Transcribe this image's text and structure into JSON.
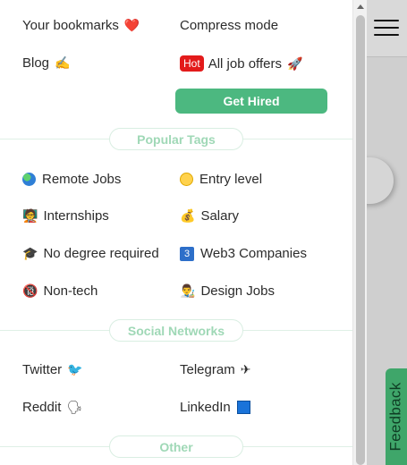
{
  "menu": {
    "bookmarks": "Your bookmarks",
    "bookmarks_icon": "❤️",
    "compress": "Compress mode",
    "blog": "Blog",
    "blog_icon": "✍️",
    "hot_badge": "Hot",
    "all_jobs": "All job offers",
    "all_jobs_icon": "🚀",
    "get_hired": "Get Hired"
  },
  "popular_tags": {
    "title": "Popular Tags",
    "items": [
      {
        "label": "Remote Jobs",
        "icon": "globe-icon"
      },
      {
        "label": "Entry level",
        "icon": "baby-face-icon"
      },
      {
        "label": "Internships",
        "icon": "student-icon",
        "glyph": "🧑‍🏫"
      },
      {
        "label": "Salary",
        "icon": "money-bag-icon",
        "glyph": "💰"
      },
      {
        "label": "No degree required",
        "icon": "graduation-cap-icon",
        "glyph": "🎓"
      },
      {
        "label": "Web3 Companies",
        "icon": "number-3-icon",
        "glyph": "3"
      },
      {
        "label": "Non-tech",
        "icon": "no-sign-icon",
        "glyph": "🔞"
      },
      {
        "label": "Design Jobs",
        "icon": "artist-icon",
        "glyph": "👨‍🎨"
      }
    ]
  },
  "social": {
    "title": "Social Networks",
    "items": [
      {
        "label": "Twitter",
        "icon": "bird-icon",
        "glyph": "🐦"
      },
      {
        "label": "Telegram",
        "icon": "plane-icon",
        "glyph": "✈"
      },
      {
        "label": "Reddit",
        "icon": "speaking-head-icon",
        "glyph": "🗣"
      },
      {
        "label": "LinkedIn",
        "icon": "blue-square-icon"
      }
    ]
  },
  "other": {
    "title": "Other"
  },
  "feedback": "Feedback",
  "colors": {
    "accent": "#4cb880",
    "hot": "#e31b1b",
    "section_text": "#9fd8b6",
    "feedback_bg": "#3fa66a"
  }
}
